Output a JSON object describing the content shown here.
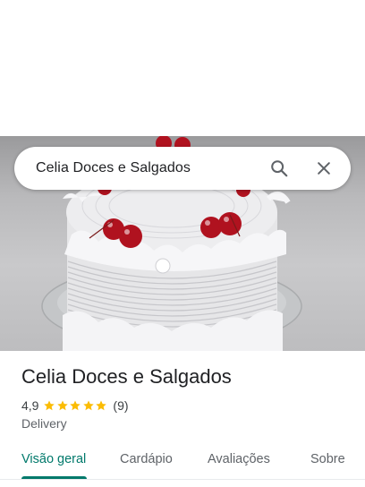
{
  "search": {
    "query": "Celia Doces e Salgados",
    "search_icon": "search-icon",
    "close_icon": "close-icon"
  },
  "photo": {
    "subject_icon": "cake-photo"
  },
  "place": {
    "name": "Celia Doces e Salgados",
    "rating": "4,9",
    "rating_value": 4.9,
    "stars_max": 5,
    "review_count": "(9)",
    "category": "Delivery"
  },
  "tabs": [
    {
      "label": "Visão geral",
      "active": true
    },
    {
      "label": "Cardápio",
      "active": false
    },
    {
      "label": "Avaliações",
      "active": false
    },
    {
      "label": "Sobre",
      "active": false
    }
  ],
  "colors": {
    "accent": "#00796b",
    "star": "#fbbc04",
    "text_primary": "#202124",
    "text_secondary": "#5f6368",
    "cherry": "#b0121f"
  }
}
